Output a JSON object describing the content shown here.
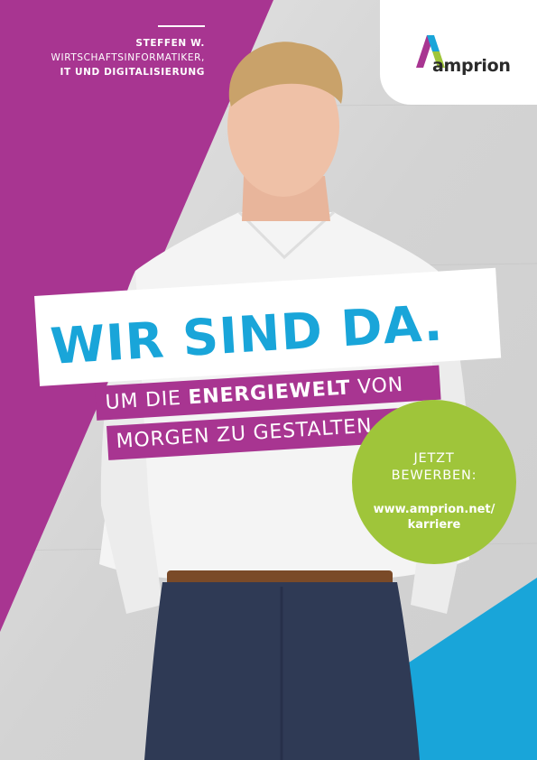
{
  "colors": {
    "magenta": "#a83591",
    "cyan": "#19a5d9",
    "lime": "#9fc53a",
    "concrete": "#d8d8d8"
  },
  "profile": {
    "name": "STEFFEN W.",
    "role_line1": "WIRTSCHAFTSINFORMATIKER,",
    "role_line2": "IT UND DIGITALISIERUNG"
  },
  "logo": {
    "icon": "amprion-a-mark-icon",
    "text": "amprion"
  },
  "headline": "WIR SIND DA.",
  "subline": {
    "line1_prefix": "UM DIE ",
    "line1_bold": "ENERGIEWELT",
    "line1_suffix": " VON",
    "line2": "MORGEN ZU GESTALTEN."
  },
  "cta": {
    "line1": "JETZT",
    "line2": "BEWERBEN:",
    "url_line1": "www.amprion.net/",
    "url_line2": "karriere"
  }
}
